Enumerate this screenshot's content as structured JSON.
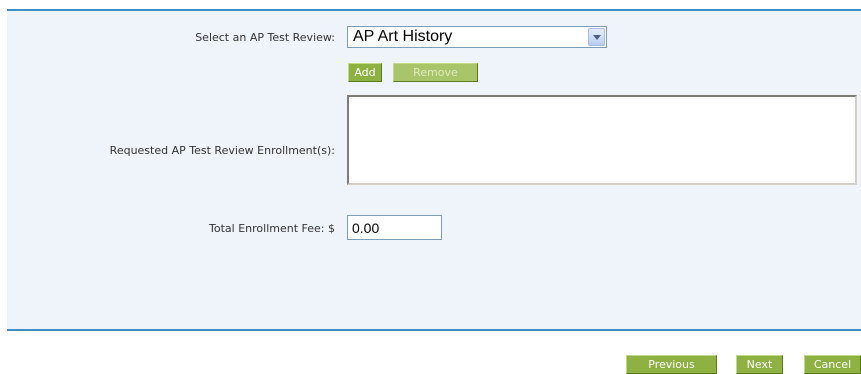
{
  "form": {
    "select_label": "Select an AP Test Review:",
    "select_value": "AP Art History",
    "add_label": "Add",
    "remove_label": "Remove",
    "requested_label": "Requested AP Test Review Enrollment(s):",
    "requested_items": [],
    "fee_label": "Total Enrollment Fee: $",
    "fee_value": "0.00"
  },
  "footer": {
    "previous_label": "Previous",
    "next_label": "Next",
    "cancel_label": "Cancel"
  },
  "colors": {
    "panel_bg": "#eff4fa",
    "panel_border": "#3d8ec3",
    "button_green": "#8db242"
  },
  "icons": {
    "select_arrow": "chevron-down-icon"
  }
}
